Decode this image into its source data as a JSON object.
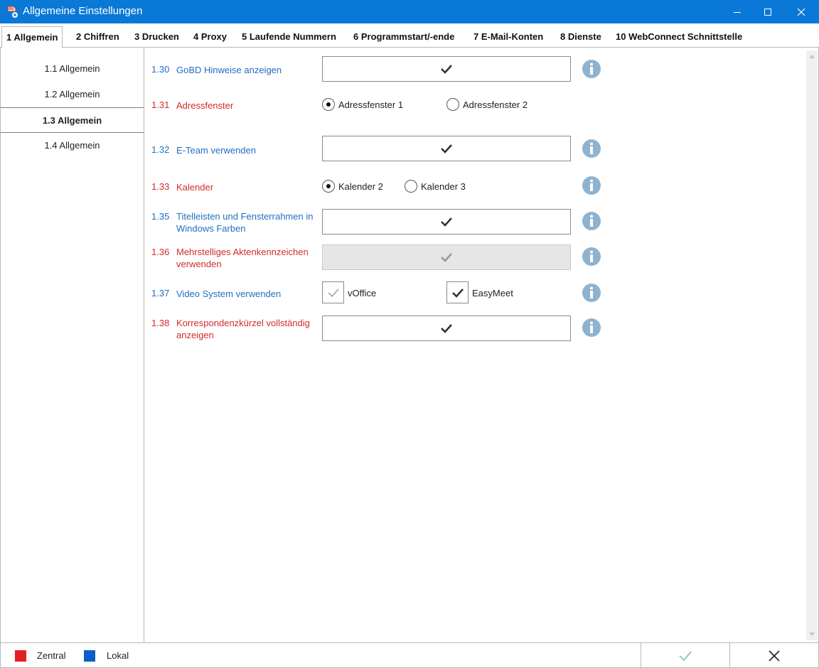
{
  "window": {
    "title": "Allgemeine Einstellungen",
    "accent_color": "#0a78d7"
  },
  "tabs": [
    {
      "label": "1 Allgemein",
      "active": true
    },
    {
      "label": "2 Chiffren"
    },
    {
      "label": "3 Drucken"
    },
    {
      "label": "4 Proxy"
    },
    {
      "label": "5 Laufende Nummern"
    },
    {
      "label": "6 Programmstart/-ende"
    },
    {
      "label": "7 E-Mail-Konten"
    },
    {
      "label": "8 Dienste"
    },
    {
      "label": "10 WebConnect Schnittstelle"
    }
  ],
  "sidebar": {
    "items": [
      {
        "label": "1.1 Allgemein"
      },
      {
        "label": "1.2 Allgemein"
      },
      {
        "label": "1.3 Allgemein",
        "active": true
      },
      {
        "label": "1.4 Allgemein"
      }
    ]
  },
  "settings": {
    "s130": {
      "num": "1.30",
      "label": "GoBD Hinweise anzeigen",
      "scope": "lokal",
      "checked": true
    },
    "s131": {
      "num": "1.31",
      "label": "Adressfenster",
      "scope": "zentral",
      "options": [
        "Adressfenster 1",
        "Adressfenster 2"
      ],
      "selected": "Adressfenster 1"
    },
    "s132": {
      "num": "1.32",
      "label": "E-Team verwenden",
      "scope": "lokal",
      "checked": true
    },
    "s133": {
      "num": "1.33",
      "label": "Kalender",
      "scope": "zentral",
      "options": [
        "Kalender 2",
        "Kalender 3"
      ],
      "selected": "Kalender 2"
    },
    "s135": {
      "num": "1.35",
      "label": "Titelleisten und Fensterrahmen in Windows Farben",
      "scope": "lokal",
      "checked": true
    },
    "s136": {
      "num": "1.36",
      "label": "Mehrstelliges Aktenkennzeichen verwenden",
      "scope": "zentral",
      "checked": true,
      "disabled": true
    },
    "s137": {
      "num": "1.37",
      "label": "Video System verwenden",
      "scope": "lokal",
      "options": [
        {
          "label": "vOffice",
          "checked": true,
          "disabled": true
        },
        {
          "label": "EasyMeet",
          "checked": true
        }
      ]
    },
    "s138": {
      "num": "1.38",
      "label": "Korrespondenzkürzel vollständig anzeigen",
      "scope": "zentral",
      "checked": true
    }
  },
  "legend": {
    "zentral": {
      "label": "Zentral",
      "color": "#e02020"
    },
    "lokal": {
      "label": "Lokal",
      "color": "#0a5fc4"
    }
  },
  "footer": {
    "ok_icon": "checkmark-icon",
    "cancel_icon": "close-icon"
  }
}
